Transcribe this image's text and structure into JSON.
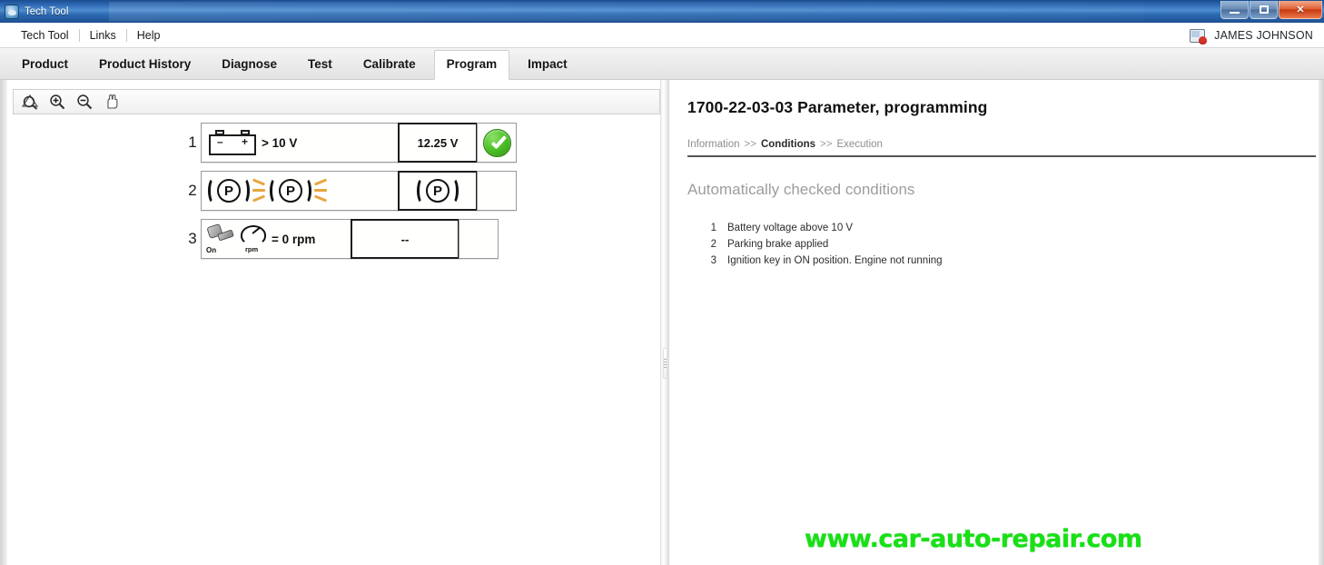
{
  "window": {
    "title": "Tech Tool",
    "icon": "app-icon",
    "buttons": {
      "minimize": "minimize",
      "maximize": "maximize",
      "close": "close"
    }
  },
  "menubar": {
    "items": [
      {
        "label": "Tech Tool"
      },
      {
        "label": "Links"
      },
      {
        "label": "Help"
      }
    ],
    "user": {
      "name": "JAMES JOHNSON",
      "icon": "user-account-icon"
    }
  },
  "tabs": [
    {
      "label": "Product",
      "active": false
    },
    {
      "label": "Product History",
      "active": false
    },
    {
      "label": "Diagnose",
      "active": false
    },
    {
      "label": "Test",
      "active": false
    },
    {
      "label": "Calibrate",
      "active": false
    },
    {
      "label": "Program",
      "active": true
    },
    {
      "label": "Impact",
      "active": false
    }
  ],
  "left_pane": {
    "toolbar": [
      {
        "name": "zoom-fit-icon",
        "title": "Zoom to fit"
      },
      {
        "name": "zoom-in-icon",
        "title": "Zoom in"
      },
      {
        "name": "zoom-out-icon",
        "title": "Zoom out"
      },
      {
        "name": "pan-hand-icon",
        "title": "Pan"
      }
    ],
    "conditions": [
      {
        "number": "1",
        "icon": "battery-icon",
        "description": "> 10 V",
        "value": "12.25 V",
        "status": "ok"
      },
      {
        "number": "2",
        "icon": "parking-brake-icon",
        "description": "",
        "value": "((P))",
        "status": ""
      },
      {
        "number": "3",
        "icon": "ignition-key-on-icon",
        "description": "= 0 rpm",
        "value": "--",
        "status": ""
      }
    ],
    "icon_labels": {
      "key_on": "On",
      "gauge_rpm": "rpm",
      "pbrake_letter": "P",
      "battery_minus": "–",
      "battery_plus": "+"
    }
  },
  "right_pane": {
    "title": "1700-22-03-03 Parameter, programming",
    "breadcrumb": [
      {
        "label": "Information",
        "active": false
      },
      {
        "label": "Conditions",
        "active": true
      },
      {
        "label": "Execution",
        "active": false
      }
    ],
    "breadcrumb_separator": ">>",
    "section_title": "Automatically checked conditions",
    "conditions": [
      {
        "index": "1",
        "text": "Battery voltage above 10 V"
      },
      {
        "index": "2",
        "text": "Parking brake applied"
      },
      {
        "index": "3",
        "text": "Ignition key in ON position. Engine not running"
      }
    ]
  },
  "watermark": {
    "text": "www.car-auto-repair.com",
    "color": "#18e016"
  }
}
